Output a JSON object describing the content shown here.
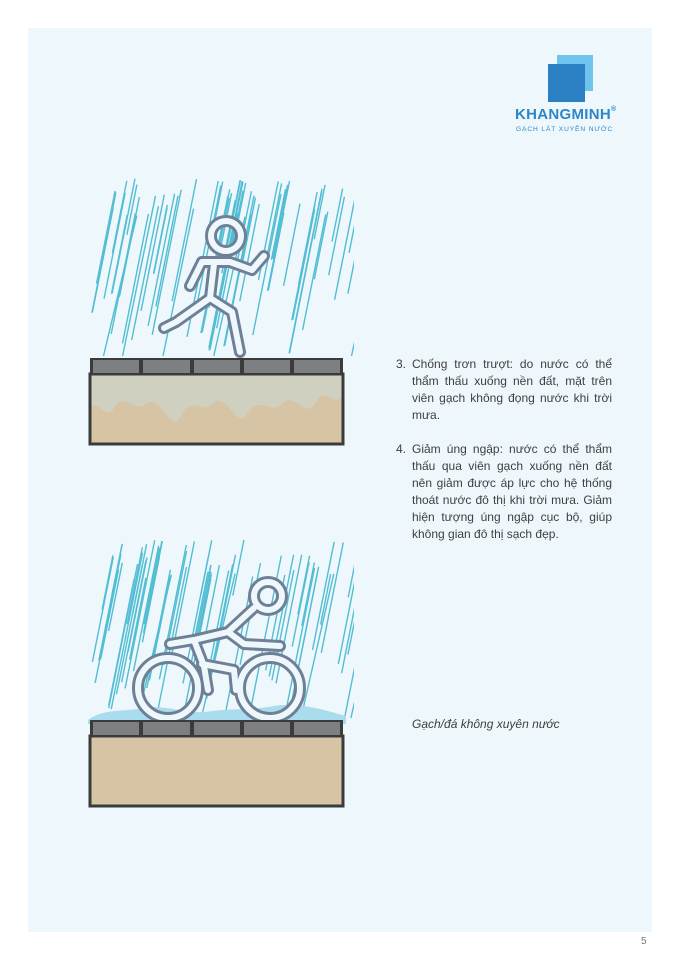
{
  "logo": {
    "brand": "KHANGMINH",
    "registered": "®",
    "tagline": "GẠCH LÁT XUYÊN NƯỚC"
  },
  "illustrations": [
    {
      "figure": "runner-on-permeable-paving",
      "icon": "running-person-icon"
    },
    {
      "figure": "cyclist-on-impermeable-paving",
      "icon": "cyclist-icon"
    }
  ],
  "benefits": [
    {
      "number": "3.",
      "text": "Chống trơn trượt: do nước có thể thẩm thấu xuống nền đất, mặt trên viên gạch không đọng nước khi trời mưa."
    },
    {
      "number": "4.",
      "text": "Giảm úng ngập: nước có thể thẩm thấu qua viên gạch xuống nền đất nên giảm được áp lực cho hệ thống thoát nước đô thị khi trời mưa. Giảm hiện tượng úng ngập cục bộ, giúp không gian đô thị sạch đẹp."
    }
  ],
  "caption": "Gạch/đá không xuyên nước",
  "page_number": "5",
  "colors": {
    "page_bg": "#eef8fc",
    "brand_blue": "#2f86c6",
    "rain": "#52bdd3",
    "figure_stroke": "#6f7f95",
    "soil": "#d6c4a4",
    "water_in_soil": "#cfd0c0",
    "tile": "#787a7c",
    "frame": "#3b3b3b",
    "puddle": "#a9dced"
  }
}
